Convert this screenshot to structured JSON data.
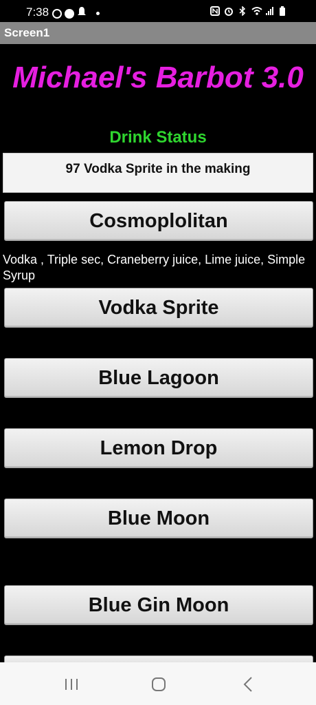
{
  "status_bar": {
    "time": "7:38",
    "left_icons": [
      "circle-icon",
      "facebook-icon",
      "alert-icon"
    ],
    "right_icons": [
      "nfc-icon",
      "alarm-icon",
      "bluetooth-icon",
      "wifi-icon",
      "signal-icon",
      "battery-icon"
    ]
  },
  "title_bar": {
    "title": "Screen1"
  },
  "app": {
    "title": "Michael's Barbot 3.0",
    "drink_status_label": "Drink Status",
    "status_text": "97 Vodka Sprite in the making",
    "ingredients_text": "Vodka , Triple sec, Craneberry juice, Lime juice, Simple Syrup",
    "drinks": [
      {
        "label": "Cosmoplolitan"
      },
      {
        "label": "Vodka Sprite"
      },
      {
        "label": "Blue Lagoon"
      },
      {
        "label": "Lemon Drop"
      },
      {
        "label": "Blue Moon"
      },
      {
        "label": "Blue Gin Moon"
      }
    ]
  },
  "colors": {
    "title": "#e61fe0",
    "drink_status": "#2fd62f",
    "background": "#000000",
    "title_bar": "#888888"
  },
  "nav": {
    "items": [
      "recents-icon",
      "home-icon",
      "back-icon"
    ]
  }
}
